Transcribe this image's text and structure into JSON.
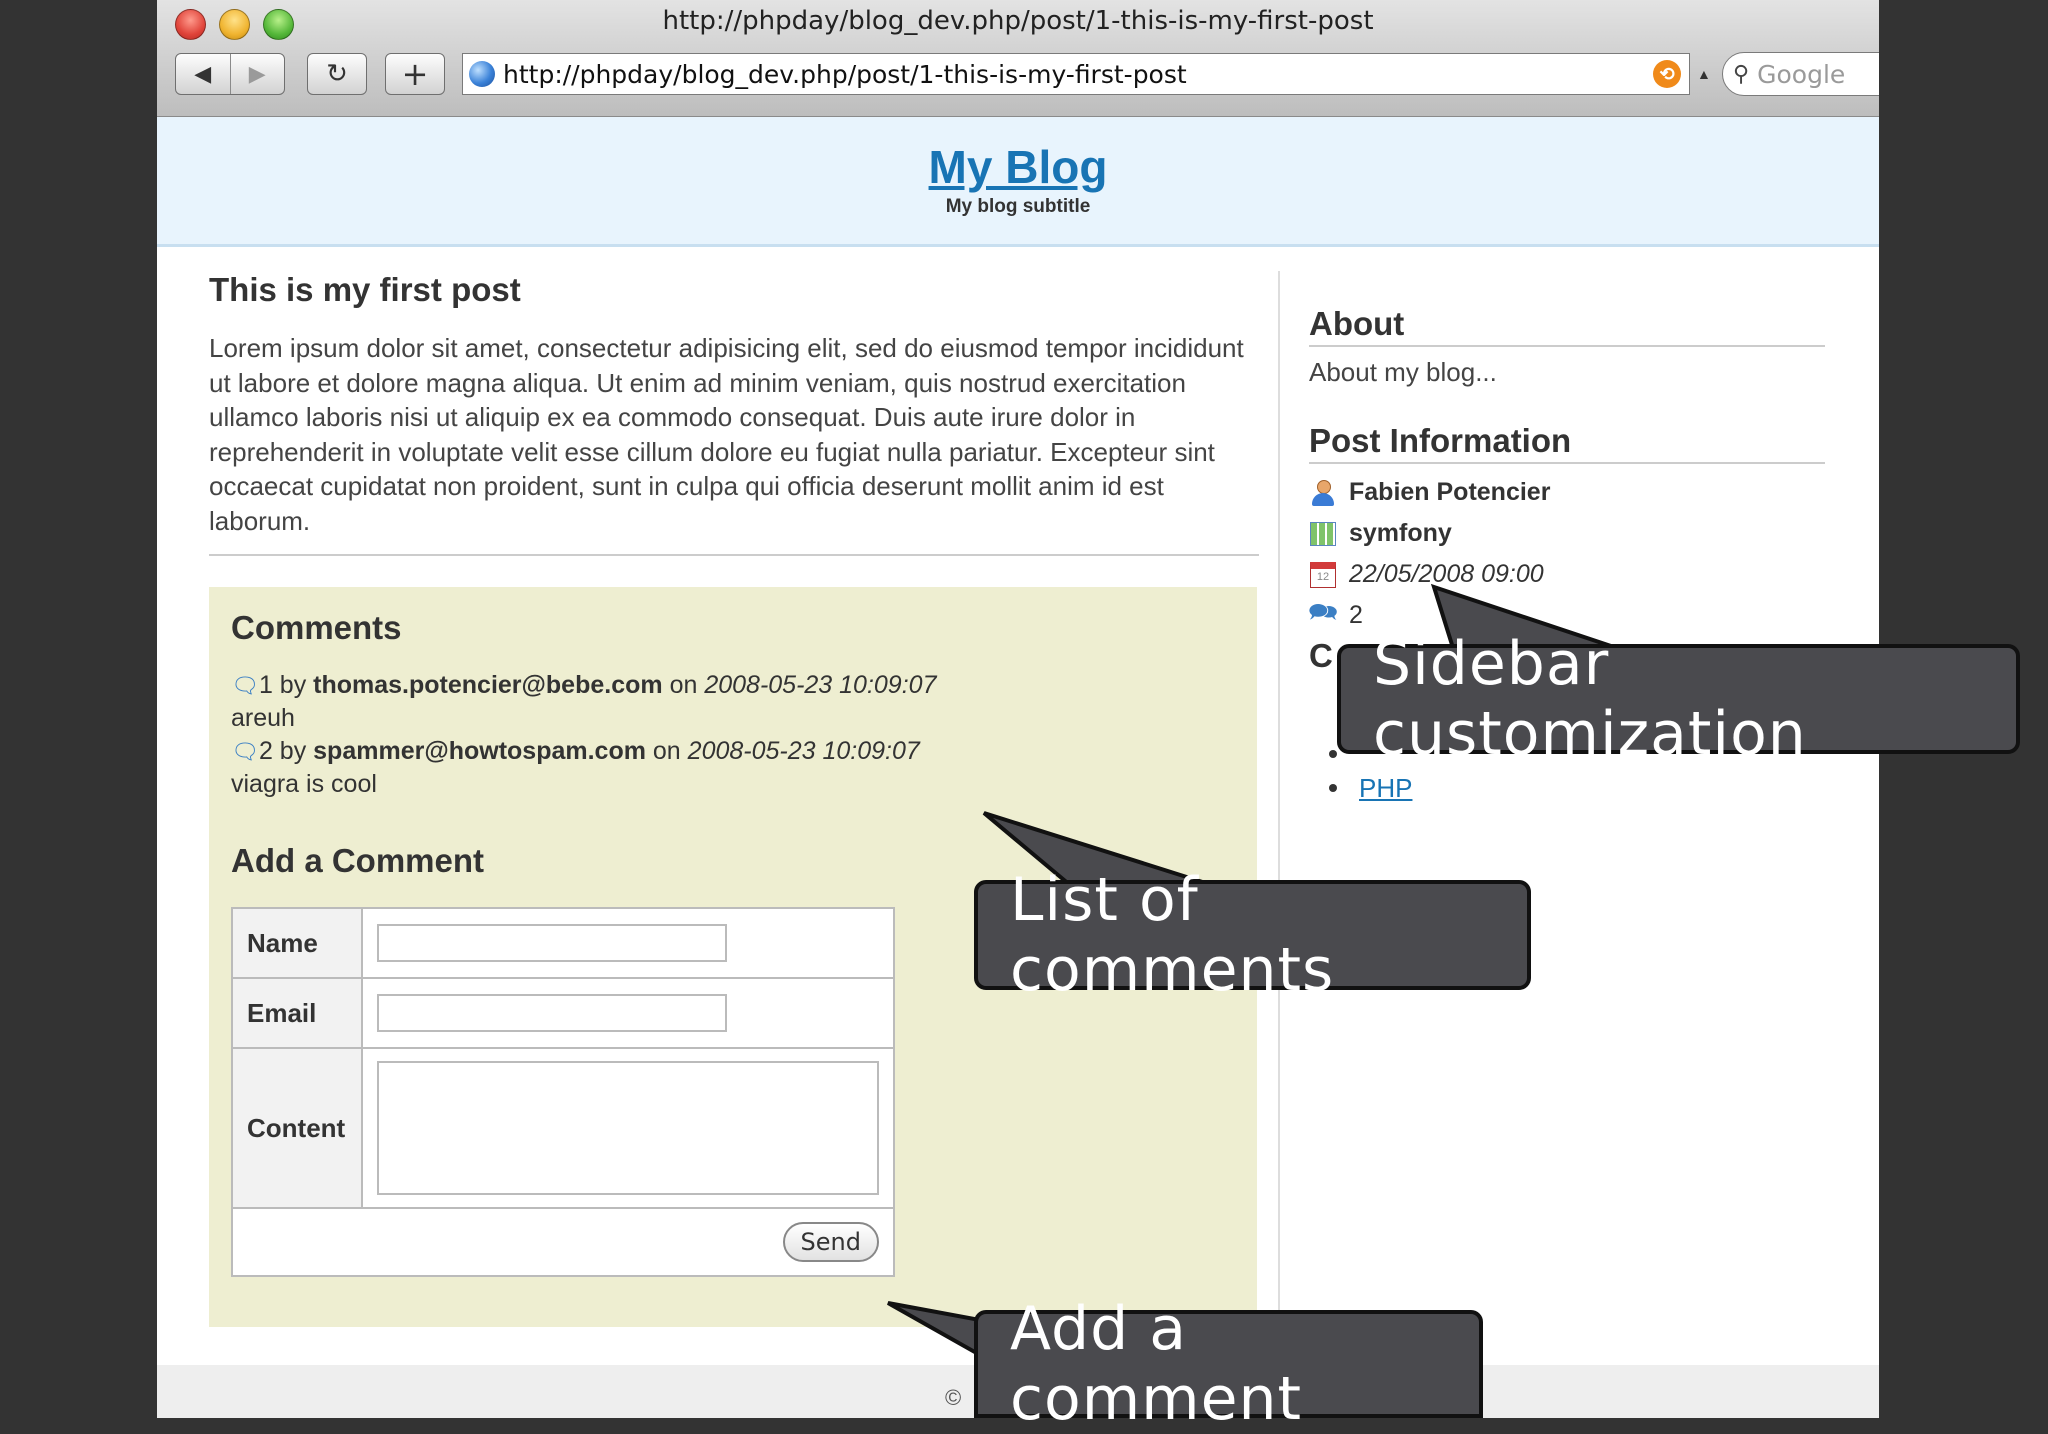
{
  "browser": {
    "window_title": "http://phpday/blog_dev.php/post/1-this-is-my-first-post",
    "url": "http://phpday/blog_dev.php/post/1-this-is-my-first-post",
    "search_placeholder": "Google",
    "back_glyph": "◀",
    "forward_glyph": "▶",
    "reload_glyph": "↻",
    "add_glyph": "+"
  },
  "blog": {
    "title": "My Blog",
    "subtitle": "My blog subtitle"
  },
  "post": {
    "title": "This is my first post",
    "body": "Lorem ipsum dolor sit amet, consectetur adipisicing elit, sed do eiusmod tempor incididunt ut labore et dolore magna aliqua. Ut enim ad minim veniam, quis nostrud exercitation ullamco laboris nisi ut aliquip ex ea commodo consequat. Duis aute irure dolor in reprehenderit in voluptate velit esse cillum dolore eu fugiat nulla pariatur. Excepteur sint occaecat cupidatat non proident, sunt in culpa qui officia deserunt mollit anim id est laborum."
  },
  "comments": {
    "heading": "Comments",
    "items": [
      {
        "number": "1",
        "by": "by",
        "author": "thomas.potencier@bebe.com",
        "on": "on",
        "date": "2008-05-23 10:09:07",
        "text": "areuh"
      },
      {
        "number": "2",
        "by": "by",
        "author": "spammer@howtospam.com",
        "on": "on",
        "date": "2008-05-23 10:09:07",
        "text": "viagra is cool"
      }
    ]
  },
  "add_comment": {
    "heading": "Add a Comment",
    "name_label": "Name",
    "email_label": "Email",
    "content_label": "Content",
    "send_label": "Send"
  },
  "sidebar": {
    "about_heading": "About",
    "about_text": "About my blog...",
    "post_info_heading": "Post Information",
    "author": "Fabien Potencier",
    "category": "symfony",
    "date": "22/05/2008 09:00",
    "comment_count": "2",
    "categories_heading_partial": "C",
    "categories": [
      "PHP"
    ]
  },
  "footer": {
    "copyright_partial": "©"
  },
  "callouts": {
    "sidebar": "Sidebar customization",
    "comments": "List of comments",
    "add": "Add a comment"
  }
}
